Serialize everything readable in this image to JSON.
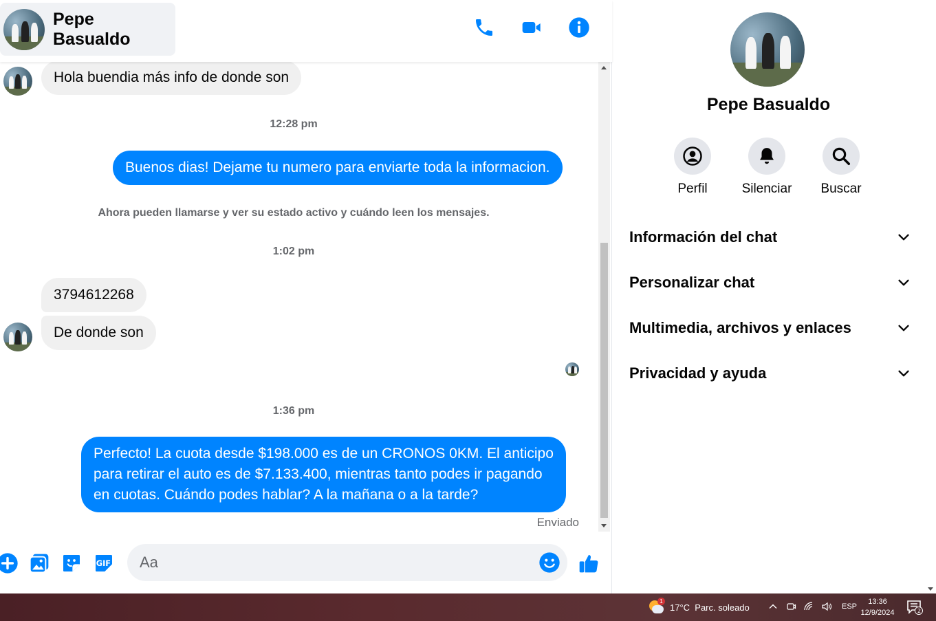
{
  "contact": {
    "name": "Pepe Basualdo"
  },
  "messages": {
    "m1": "Hola buendia más info de donde son",
    "t1": "12:28 pm",
    "m2": "Buenos dias! Dejame tu numero para enviarte toda la informacion.",
    "system": "Ahora pueden llamarse y ver su estado activo y cuándo leen los mensajes.",
    "t2": "1:02 pm",
    "m3": "3794612268",
    "m4": "De donde son",
    "t3": "1:36 pm",
    "m5_line1": "Perfecto! La cuota desde $198.000 es de un CRONOS 0KM. El anticipo",
    "m5_line2": "para retirar el auto es de $7.133.400, mientras tanto podes ir pagando",
    "m5_line3": "en cuotas. Cuándo podes hablar? A la mañana o a la tarde?",
    "status": "Enviado"
  },
  "composer": {
    "placeholder": "Aa"
  },
  "panel": {
    "name": "Pepe Basualdo",
    "actions": [
      {
        "label": "Perfil",
        "icon": "profile-icon"
      },
      {
        "label": "Silenciar",
        "icon": "bell-icon"
      },
      {
        "label": "Buscar",
        "icon": "search-icon"
      }
    ],
    "sections": [
      "Información del chat",
      "Personalizar chat",
      "Multimedia, archivos y enlaces",
      "Privacidad y ayuda"
    ]
  },
  "taskbar": {
    "weather": "17°C  Parc. soleado",
    "weather_badge": "1",
    "lang": "ESP",
    "time": "13:36",
    "date": "12/9/2024",
    "notif_count": "2"
  },
  "colors": {
    "accent": "#0084ff",
    "bubble_in": "#f0f0f0"
  }
}
